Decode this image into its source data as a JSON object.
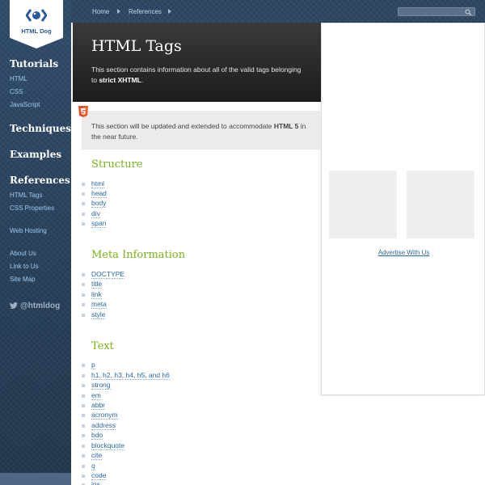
{
  "logo": {
    "text": "HTML Dog"
  },
  "sidebar": {
    "tutorials": {
      "title": "Tutorials",
      "items": [
        "HTML",
        "CSS",
        "JavaScript"
      ]
    },
    "techniques": "Techniques",
    "examples": "Examples",
    "references": {
      "title": "References",
      "items": [
        "HTML Tags",
        "CSS Properties"
      ]
    },
    "extra_1": [
      "Web Hosting"
    ],
    "extra_2": [
      "About Us",
      "Link to Us",
      "Site Map"
    ],
    "twitter": "@htmldog"
  },
  "breadcrumb": {
    "home": "Home",
    "references": "References"
  },
  "header": {
    "title": "HTML Tags",
    "intro_prefix": "This section contains information about all of the valid tags belonging to ",
    "intro_bold": "strict XHTML",
    "intro_suffix": "."
  },
  "notice": {
    "text_prefix": "This section will be updated and extended to accommodate ",
    "text_bold": "HTML 5",
    "text_suffix": " in the near future."
  },
  "ad": {
    "link": "Advertise With Us"
  },
  "sections": [
    {
      "title": "Structure",
      "items": [
        "html",
        "head",
        "body",
        "div",
        "span"
      ]
    },
    {
      "title": "Meta Information",
      "items": [
        "DOCTYPE",
        "title",
        "link",
        "meta",
        "style"
      ]
    },
    {
      "title": "Text",
      "items": [
        "p",
        "h1, h2, h3, h4, h5, and h6",
        "strong",
        "em",
        "abbr",
        "acronym",
        "address",
        "bdo",
        "blockquote",
        "cite",
        "q",
        "code",
        "ins"
      ]
    }
  ],
  "colors": {
    "accent": "#7bb31a",
    "link": "#2b68a8",
    "sidebar": "#2b4460"
  }
}
